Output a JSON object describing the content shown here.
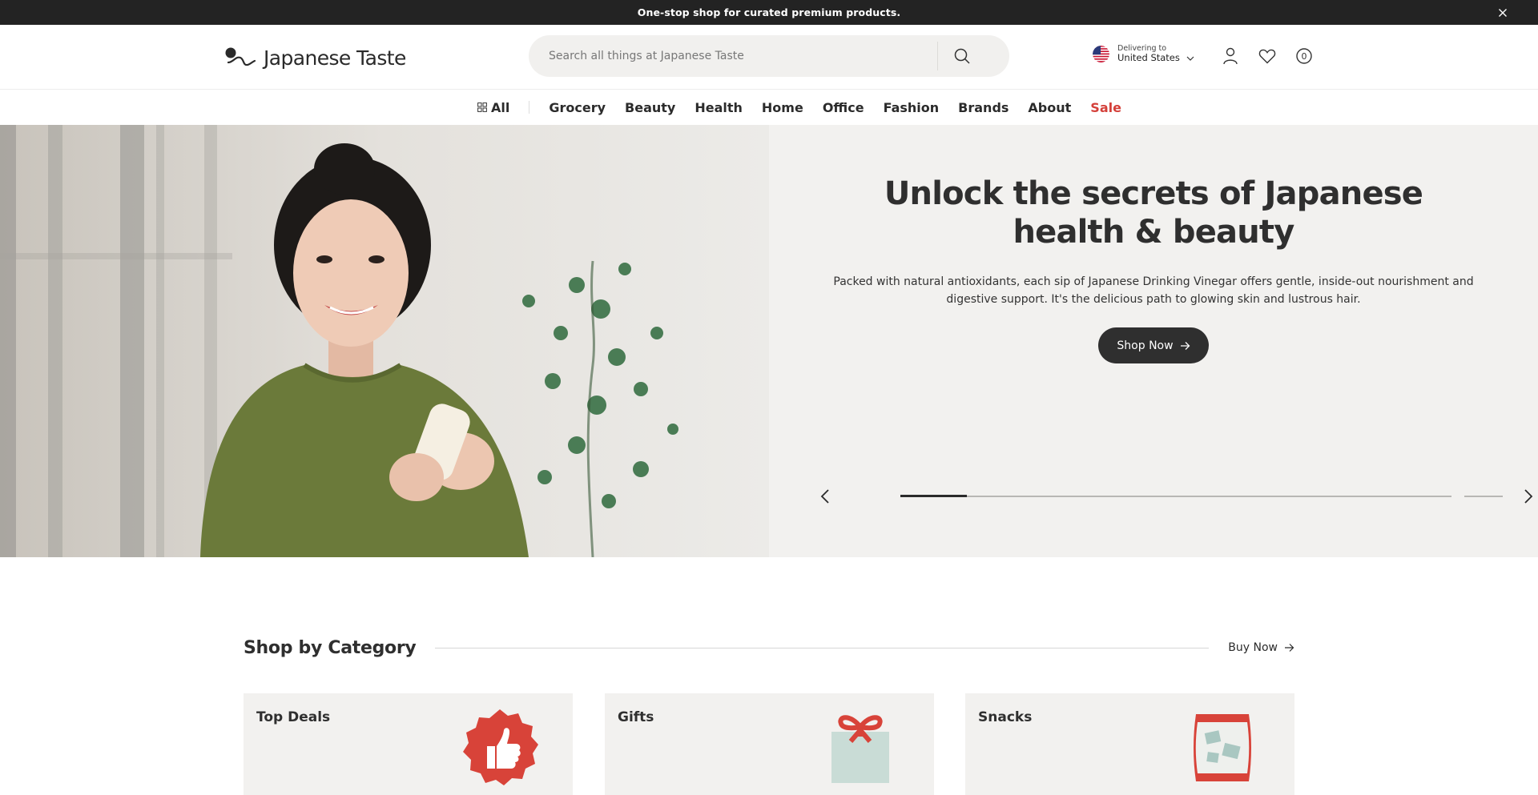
{
  "announcement": {
    "text": "One-stop shop for curated premium products."
  },
  "header": {
    "brand": "Japanese Taste",
    "search_placeholder": "Search all things at Japanese Taste",
    "delivery_label": "Delivering to",
    "delivery_country": "United States",
    "cart_count": "0"
  },
  "nav": {
    "all_label": "All",
    "items": [
      "Grocery",
      "Beauty",
      "Health",
      "Home",
      "Office",
      "Fashion",
      "Brands",
      "About",
      "Sale"
    ],
    "sale_color": "#d4403a"
  },
  "hero": {
    "title": "Unlock the secrets of Japanese health & beauty",
    "body": "Packed with natural antioxidants, each sip of Japanese Drinking Vinegar offers gentle, inside-out nourishment and digestive support. It's the delicious path to glowing skin and lustrous hair.",
    "cta": "Shop Now",
    "slide_progress": 0.12
  },
  "categories": {
    "heading": "Shop by Category",
    "link": "Buy Now",
    "cards": [
      {
        "title": "Top Deals",
        "icon": "thumbs-up-badge-icon"
      },
      {
        "title": "Gifts",
        "icon": "gift-box-icon"
      },
      {
        "title": "Snacks",
        "icon": "snack-bag-icon"
      }
    ]
  },
  "colors": {
    "dark": "#2f2f2f",
    "accent_red": "#d4403a",
    "panel": "#f2f1ef",
    "topbar": "#232323"
  }
}
